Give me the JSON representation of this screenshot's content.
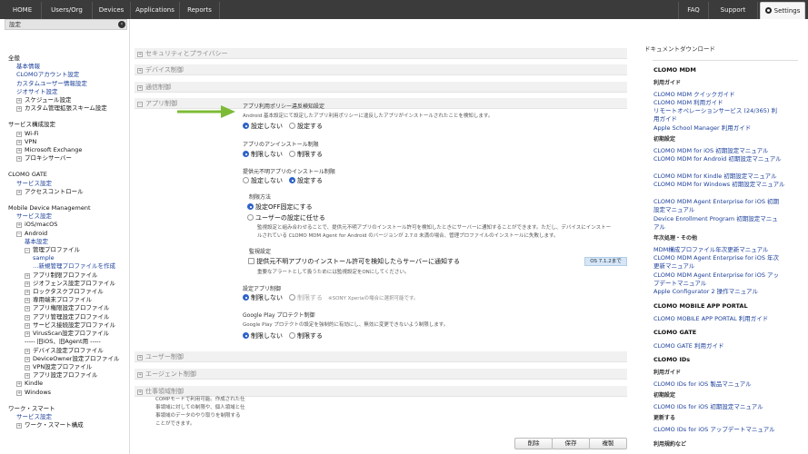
{
  "nav": {
    "tabs": [
      "HOME",
      "Users/Org",
      "Devices",
      "Applications",
      "Reports"
    ],
    "faq": "FAQ",
    "support": "Support",
    "settings": "Settings"
  },
  "sidebar": {
    "header": "設定",
    "items": [
      "全般",
      "基本情報",
      "CLOMOアカウント設定",
      "カスタムユーザー情報設定",
      "ジオサイト設定",
      "スケジュール設定",
      "カスタム管理拡張スキーム設定",
      "サービス構成設定",
      "Wi-Fi",
      "VPN",
      "Microsoft Exchange",
      "プロキシサーバー",
      "CLOMO GATE",
      "サービス設定",
      "アクセスコントロール",
      "Mobile Device Management",
      "サービス設定",
      "iOS/macOS",
      "Android",
      "基本設定",
      "管理プロファイル",
      "sample",
      "新規管理プロファイルを作成",
      "アプリ制限プロファイル",
      "ジオフェンス設定プロファイル",
      "ロックタスクプロファイル",
      "専用端末プロファイル",
      "アプリ権限設定プロファイル",
      "アプリ管理設定プロファイル",
      "サービス接続設定プロファイル",
      "VirusScan設定プロファイル",
      "----- 旧iOS、旧Agent用 -----",
      "デバイス設定プロファイル",
      "DeviceOwner設定プロファイル",
      "VPN設定プロファイル",
      "アプリ設定プロファイル",
      "Kindle",
      "Windows",
      "ワーク・スマート",
      "サービス設定",
      "ワーク・スマート構成"
    ]
  },
  "main": {
    "sections": [
      "セキュリティとプライバシー",
      "デバイス制御",
      "通信制御",
      "アプリ制御",
      "ユーザー制御",
      "エージェント制御",
      "仕事領域制御"
    ],
    "work_area_desc": [
      "COMPモードで利用可能。作成された仕",
      "事領域に対しての制限や、個人領域と仕",
      "事領域のデータのやり取りを制限する",
      "ことができます。"
    ],
    "app_control": {
      "policy_violation_label": "アプリ利用ポリシー違反検知設定",
      "policy_violation_desc": "Android 基本設定にて設定したアプリ利用ポリシーに違反したアプリがインストールされたことを検知します。",
      "opt_no_setting": "設定しない",
      "opt_setting": "設定する",
      "uninstall_label": "アプリのアンインストール制限",
      "opt_no_restrict": "制限しない",
      "opt_restrict": "制限する",
      "unknown_source_label": "提供元不明アプリのインストール制限",
      "restrict_method_label": "制限方法",
      "opt_fixed_off": "設定OFF固定にする",
      "opt_user_choice": "ユーザーの設定に任せる",
      "restrict_method_desc_1": "監視設定と組み合わせることで、提供元不明アプリのインストール許可を検知したときにサーバーに通知することができます。ただし、デバイスにインストー",
      "restrict_method_desc_2": "ルされている CLOMO MDM Agent for Android のバージョンが 2.7.0 未満の場合、管理プロファイルのインストールに失敗します。",
      "monitor_label": "監視設定",
      "monitor_checkbox": "提供元不明アプリのインストール許可を検知したらサーバーに通知する",
      "monitor_tag": "OS 7.1.2まで",
      "monitor_desc": "重要なアラートとして扱うためには監視設定をONにしてください。",
      "config_app_label": "設定アプリ制御",
      "config_app_note": "※SONY Xperiaの場合に選択可能です。",
      "play_protect_label": "Google Play プロテクト制御",
      "play_protect_desc": "Google Play プロテクトの設定を強制的に有効にし、無効に変更できないよう制限します。"
    },
    "buttons": {
      "delete": "削除",
      "save": "保存",
      "copy": "複製"
    }
  },
  "right": {
    "title": "ドキュメントダウンロード",
    "mdm_title": "CLOMO MDM",
    "usage_guide": "利用ガイド",
    "mdm_links": [
      "CLOMO MDM クイックガイド",
      "CLOMO MDM 利用ガイド",
      "リモートオペレーションサービス (24/365) 利",
      "用ガイド",
      "Apple School Manager 利用ガイド"
    ],
    "initial_setup": "初期設定",
    "setup_links": [
      "CLOMO MDM for iOS 初期設定マニュアル",
      "CLOMO MDM for Android 初期設定マニュアル",
      "CLOMO MDM for Kindle 初期設定マニュアル",
      "CLOMO MDM for Windows 初期設定マニュアル",
      "CLOMO MDM Agent Enterprise for iOS 初期",
      "設定マニュアル",
      "Device Enrollment Program 初期設定マニュ",
      "アル"
    ],
    "yearly": "年次処理・その他",
    "yearly_links": [
      "MDM構成プロファイル年次更新マニュアル",
      "CLOMO MDM Agent Enterprise for iOS 年次",
      "更新マニュアル",
      "CLOMO MDM Agent Enterprise for iOS アッ",
      "プデートマニュアル",
      "Apple Configurator 2 操作マニュアル"
    ],
    "portal_title": "CLOMO MOBILE APP PORTAL",
    "portal_link": "CLOMO MOBILE APP PORTAL 利用ガイド",
    "gate_title": "CLOMO GATE",
    "gate_link": "CLOMO GATE 利用ガイド",
    "ids_title": "CLOMO IDs",
    "ids_usage": "利用ガイド",
    "ids_usage_link": "CLOMO IDs for iOS 製品マニュアル",
    "ids_setup": "初期設定",
    "ids_setup_link": "CLOMO IDs for iOS 初期設定マニュアル",
    "ids_update": "更新する",
    "ids_update_link": "CLOMO IDs for iOS アップデートマニュアル",
    "terms": "利用規約など"
  }
}
